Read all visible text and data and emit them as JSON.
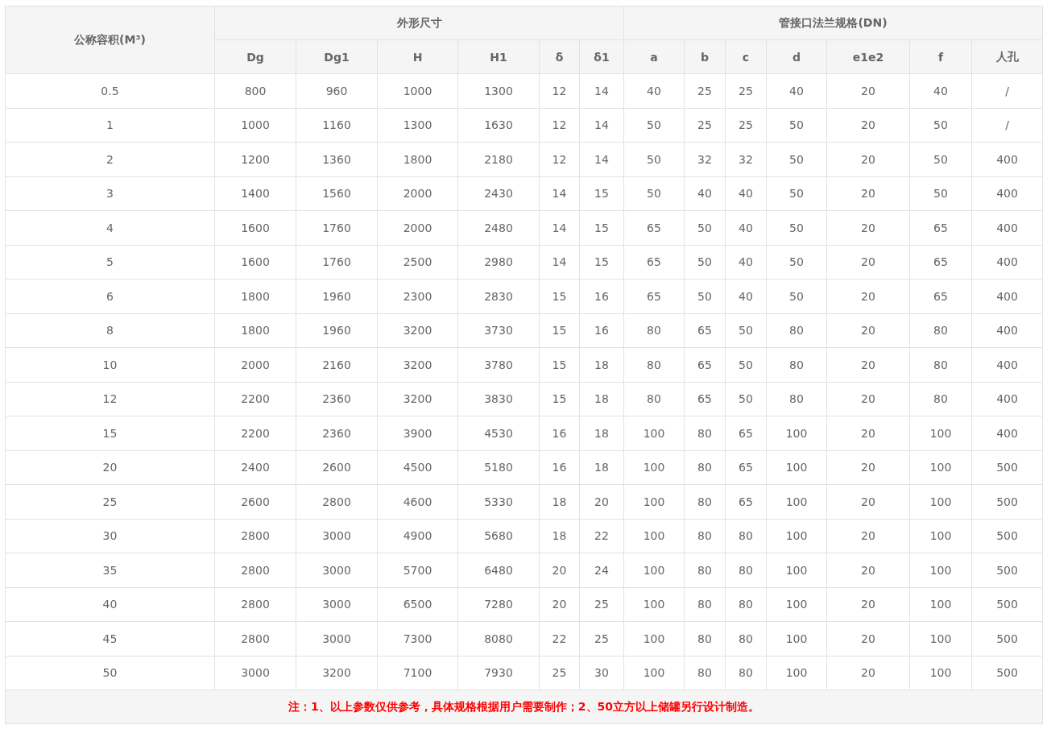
{
  "table": {
    "column_groups": [
      {
        "label": "外形尺寸"
      },
      {
        "label": "管接口法兰规格(DN)"
      }
    ],
    "columns": [
      {
        "label": "公称容积(M³)"
      },
      {
        "label": "Dg"
      },
      {
        "label": "Dg1"
      },
      {
        "label": "H"
      },
      {
        "label": "H1"
      },
      {
        "label": "δ"
      },
      {
        "label": "δ1"
      },
      {
        "label": "a"
      },
      {
        "label": "b"
      },
      {
        "label": "c"
      },
      {
        "label": "d"
      },
      {
        "label": "e1e2"
      },
      {
        "label": "f"
      },
      {
        "label": "人孔"
      }
    ],
    "rows": [
      [
        "0.5",
        "800",
        "960",
        "1000",
        "1300",
        "12",
        "14",
        "40",
        "25",
        "25",
        "40",
        "20",
        "40",
        "/"
      ],
      [
        "1",
        "1000",
        "1160",
        "1300",
        "1630",
        "12",
        "14",
        "50",
        "25",
        "25",
        "50",
        "20",
        "50",
        "/"
      ],
      [
        "2",
        "1200",
        "1360",
        "1800",
        "2180",
        "12",
        "14",
        "50",
        "32",
        "32",
        "50",
        "20",
        "50",
        "400"
      ],
      [
        "3",
        "1400",
        "1560",
        "2000",
        "2430",
        "14",
        "15",
        "50",
        "40",
        "40",
        "50",
        "20",
        "50",
        "400"
      ],
      [
        "4",
        "1600",
        "1760",
        "2000",
        "2480",
        "14",
        "15",
        "65",
        "50",
        "40",
        "50",
        "20",
        "65",
        "400"
      ],
      [
        "5",
        "1600",
        "1760",
        "2500",
        "2980",
        "14",
        "15",
        "65",
        "50",
        "40",
        "50",
        "20",
        "65",
        "400"
      ],
      [
        "6",
        "1800",
        "1960",
        "2300",
        "2830",
        "15",
        "16",
        "65",
        "50",
        "40",
        "50",
        "20",
        "65",
        "400"
      ],
      [
        "8",
        "1800",
        "1960",
        "3200",
        "3730",
        "15",
        "16",
        "80",
        "65",
        "50",
        "80",
        "20",
        "80",
        "400"
      ],
      [
        "10",
        "2000",
        "2160",
        "3200",
        "3780",
        "15",
        "18",
        "80",
        "65",
        "50",
        "80",
        "20",
        "80",
        "400"
      ],
      [
        "12",
        "2200",
        "2360",
        "3200",
        "3830",
        "15",
        "18",
        "80",
        "65",
        "50",
        "80",
        "20",
        "80",
        "400"
      ],
      [
        "15",
        "2200",
        "2360",
        "3900",
        "4530",
        "16",
        "18",
        "100",
        "80",
        "65",
        "100",
        "20",
        "100",
        "400"
      ],
      [
        "20",
        "2400",
        "2600",
        "4500",
        "5180",
        "16",
        "18",
        "100",
        "80",
        "65",
        "100",
        "20",
        "100",
        "500"
      ],
      [
        "25",
        "2600",
        "2800",
        "4600",
        "5330",
        "18",
        "20",
        "100",
        "80",
        "65",
        "100",
        "20",
        "100",
        "500"
      ],
      [
        "30",
        "2800",
        "3000",
        "4900",
        "5680",
        "18",
        "22",
        "100",
        "80",
        "80",
        "100",
        "20",
        "100",
        "500"
      ],
      [
        "35",
        "2800",
        "3000",
        "5700",
        "6480",
        "20",
        "24",
        "100",
        "80",
        "80",
        "100",
        "20",
        "100",
        "500"
      ],
      [
        "40",
        "2800",
        "3000",
        "6500",
        "7280",
        "20",
        "25",
        "100",
        "80",
        "80",
        "100",
        "20",
        "100",
        "500"
      ],
      [
        "45",
        "2800",
        "3000",
        "7300",
        "8080",
        "22",
        "25",
        "100",
        "80",
        "80",
        "100",
        "20",
        "100",
        "500"
      ],
      [
        "50",
        "3000",
        "3200",
        "7100",
        "7930",
        "25",
        "30",
        "100",
        "80",
        "80",
        "100",
        "20",
        "100",
        "500"
      ]
    ],
    "note": "注：1、以上参数仅供参考，具体规格根据用户需要制作；2、50立方以上储罐另行设计制造。"
  }
}
